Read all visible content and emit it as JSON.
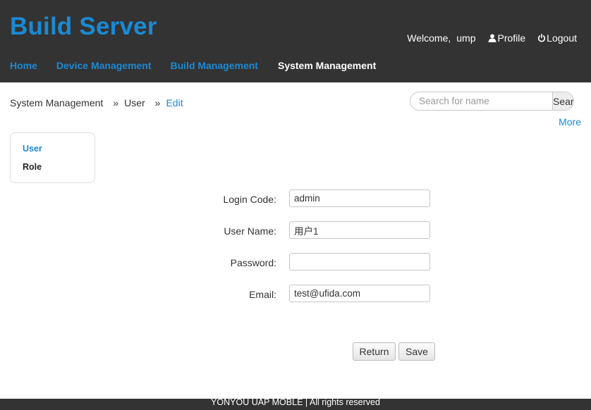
{
  "header": {
    "app_title": "Build Server",
    "welcome": "Welcome,",
    "username": "ump",
    "profile_label": "Profile",
    "profile_icon": "user-icon",
    "logout_label": "Logout",
    "logout_icon": "power-icon"
  },
  "nav": {
    "items": [
      {
        "label": "Home",
        "active": false
      },
      {
        "label": "Device Management",
        "active": false
      },
      {
        "label": "Build Management",
        "active": false
      },
      {
        "label": "System Management",
        "active": true
      }
    ]
  },
  "breadcrumb": {
    "items": [
      "System Management",
      "User",
      "Edit"
    ],
    "separator": "»"
  },
  "search": {
    "placeholder": "Search for name",
    "value": "",
    "button_label": "Search"
  },
  "more_label": "More",
  "sidebar": {
    "items": [
      {
        "label": "User",
        "active": true
      },
      {
        "label": "Role",
        "active": false
      }
    ]
  },
  "form": {
    "login_code": {
      "label": "Login Code:",
      "value": "admin"
    },
    "user_name": {
      "label": "User Name:",
      "value": "用户1"
    },
    "password": {
      "label": "Password:",
      "value": ""
    },
    "email": {
      "label": "Email:",
      "value": "test@ufida.com"
    }
  },
  "buttons": {
    "return_label": "Return",
    "save_label": "Save"
  },
  "footer": {
    "text": "YONYOU UAP MOBLE | All rights reserved"
  },
  "colors": {
    "header_bg": "#333333",
    "accent": "#1a8ad4",
    "nav_active": "#ffffff"
  }
}
